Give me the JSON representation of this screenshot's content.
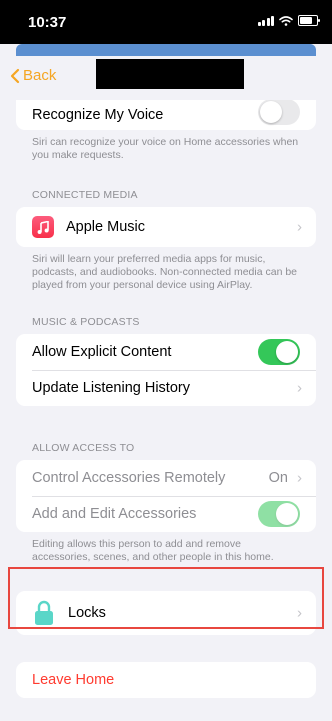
{
  "status": {
    "time": "10:37"
  },
  "nav": {
    "back_label": "Back"
  },
  "voice": {
    "label": "Recognize My Voice",
    "footer": "Siri can recognize your voice on Home accessories when you make requests."
  },
  "connected_media": {
    "header": "CONNECTED MEDIA",
    "apple_music_label": "Apple Music",
    "footer": "Siri will learn your preferred media apps for music, podcasts, and audiobooks. Non-connected media can be played from your personal device using AirPlay."
  },
  "music_podcasts": {
    "header": "MUSIC & PODCASTS",
    "explicit_label": "Allow Explicit Content",
    "history_label": "Update Listening History"
  },
  "access": {
    "header": "ALLOW ACCESS TO",
    "control_label": "Control Accessories Remotely",
    "control_value": "On",
    "add_edit_label": "Add and Edit Accessories",
    "footer": "Editing allows this person to add and remove accessories, scenes, and other people in this home."
  },
  "locks": {
    "label": "Locks"
  },
  "leave": {
    "label": "Leave Home"
  },
  "colors": {
    "accent": "#f5a623",
    "toggle_on": "#34c759",
    "destructive": "#ff3b30",
    "highlight": "#e8473f"
  }
}
